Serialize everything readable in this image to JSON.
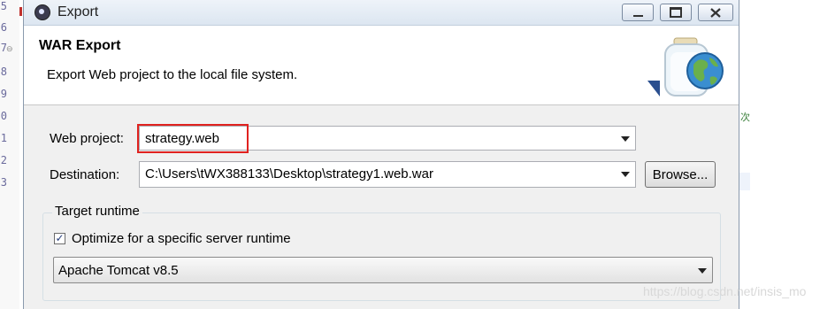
{
  "editor": {
    "line_numbers": [
      "5",
      "6",
      "7",
      "8",
      "9",
      "0",
      "1",
      "2",
      "3"
    ],
    "side_char": "次"
  },
  "window": {
    "title": "Export",
    "icon": "eclipse-icon",
    "controls": [
      "minimize-icon",
      "maximize-icon",
      "close-icon"
    ]
  },
  "header": {
    "title": "WAR Export",
    "description": "Export Web project to the local file system.",
    "image_icon": "war-jar-globe-icon"
  },
  "form": {
    "web_project_label": "Web project:",
    "web_project_value": "strategy.web",
    "destination_label": "Destination:",
    "destination_value": "C:\\Users\\tWX388133\\Desktop\\strategy1.web.war",
    "browse_label": "Browse..."
  },
  "target_runtime": {
    "group_label": "Target runtime",
    "optimize_label": "Optimize for a specific server runtime",
    "optimize_checked": true,
    "runtime_value": "Apache Tomcat v8.5"
  },
  "watermark": "https://blog.csdn.net/insis_mo",
  "colors": {
    "highlight": "#e0221f",
    "title_gradient_top": "#eef3f9",
    "title_gradient_bottom": "#dce6f1"
  }
}
